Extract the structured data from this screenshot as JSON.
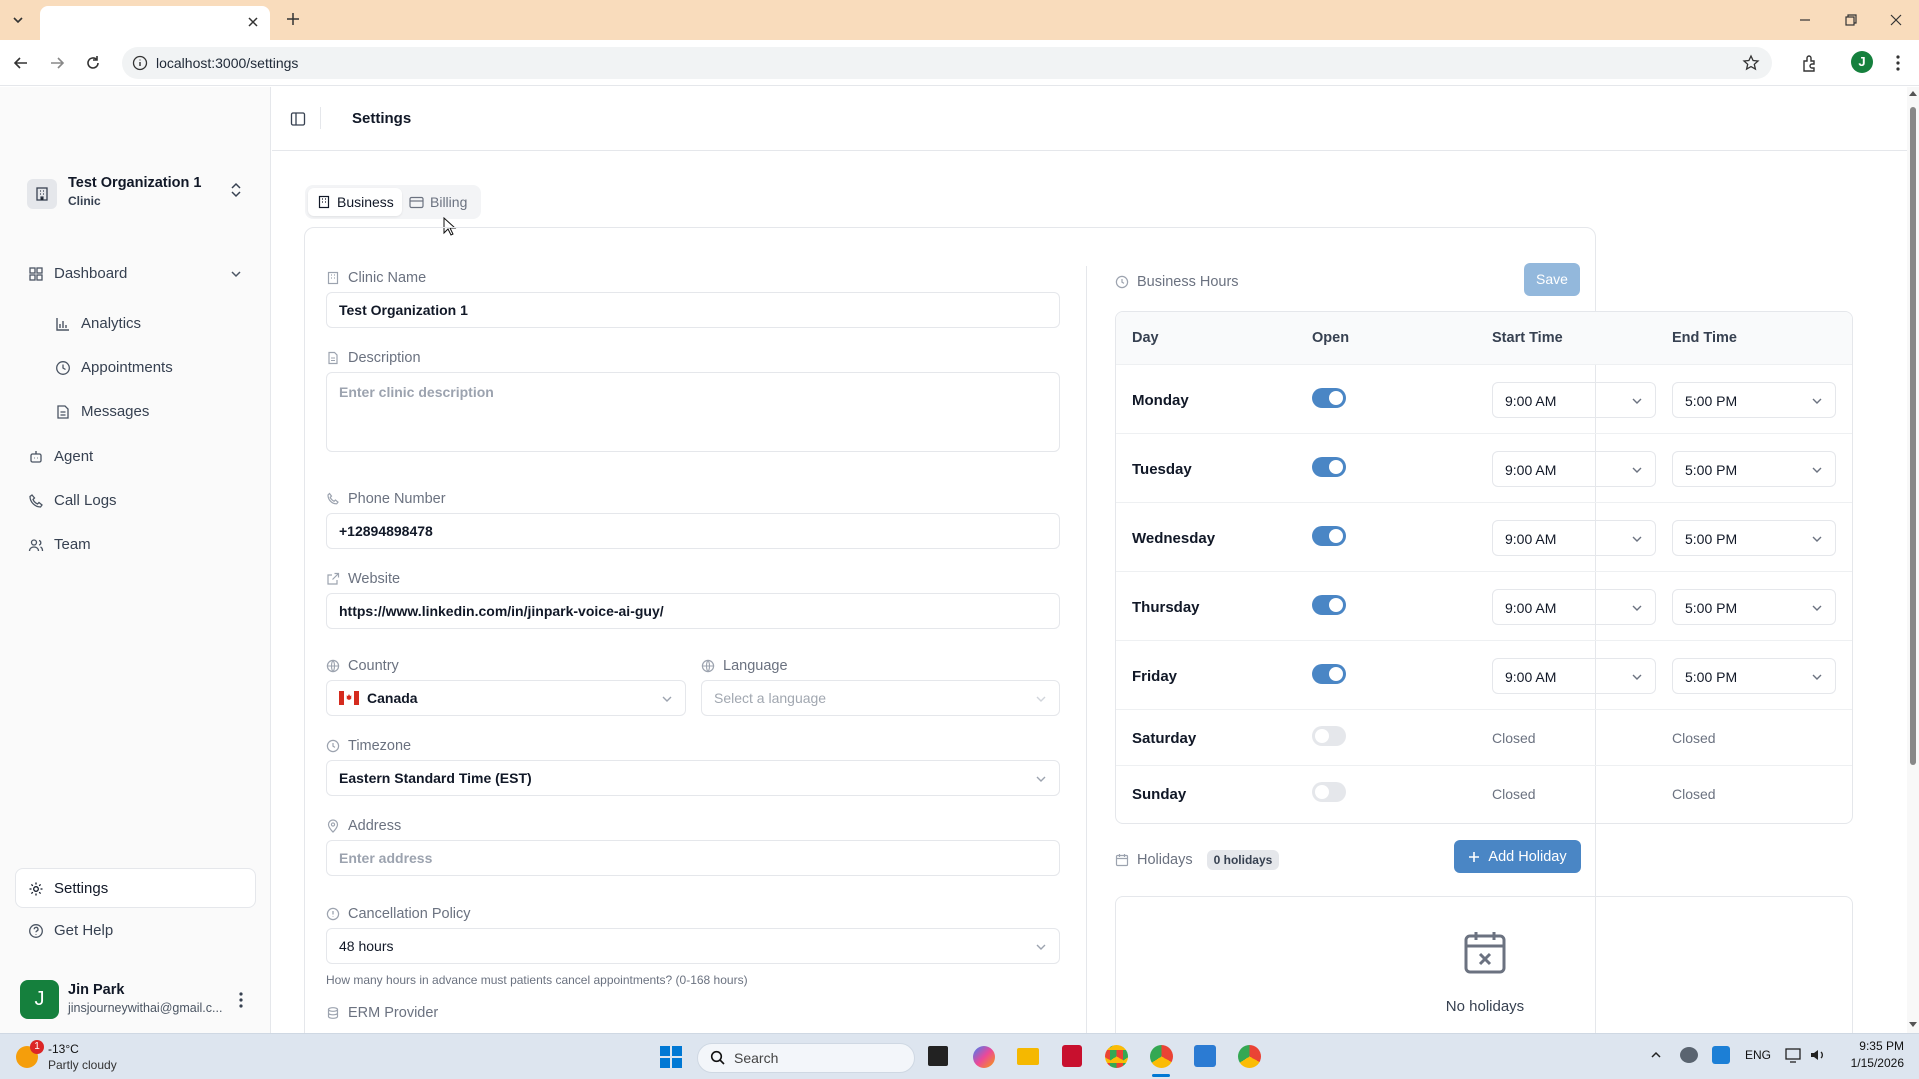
{
  "browser": {
    "url": "localhost:3000/settings",
    "profile_initial": "J"
  },
  "org": {
    "name": "Test Organization 1",
    "type": "Clinic"
  },
  "sidebar": {
    "dashboard": "Dashboard",
    "analytics": "Analytics",
    "appointments": "Appointments",
    "messages": "Messages",
    "agent": "Agent",
    "call_logs": "Call Logs",
    "team": "Team",
    "settings": "Settings",
    "get_help": "Get Help"
  },
  "user": {
    "initial": "J",
    "name": "Jin Park",
    "email": "jinsjourneywithai@gmail.c..."
  },
  "header": {
    "title": "Settings"
  },
  "tabs": {
    "business": "Business",
    "billing": "Billing"
  },
  "form": {
    "clinic_name_label": "Clinic Name",
    "clinic_name_value": "Test Organization 1",
    "description_label": "Description",
    "description_placeholder": "Enter clinic description",
    "phone_label": "Phone Number",
    "phone_value": "+12894898478",
    "website_label": "Website",
    "website_value": "https://www.linkedin.com/in/jinpark-voice-ai-guy/",
    "country_label": "Country",
    "country_value": "Canada",
    "language_label": "Language",
    "language_placeholder": "Select a language",
    "timezone_label": "Timezone",
    "timezone_value": "Eastern Standard Time (EST)",
    "address_label": "Address",
    "address_placeholder": "Enter address",
    "cancellation_label": "Cancellation Policy",
    "cancellation_value": "48 hours",
    "cancellation_help": "How many hours in advance must patients cancel appointments? (0-168 hours)",
    "erm_label": "ERM Provider"
  },
  "hours": {
    "title": "Business Hours",
    "save": "Save",
    "col_day": "Day",
    "col_open": "Open",
    "col_start": "Start Time",
    "col_end": "End Time",
    "days": [
      {
        "name": "Monday",
        "open": true,
        "start": "9:00 AM",
        "end": "5:00 PM"
      },
      {
        "name": "Tuesday",
        "open": true,
        "start": "9:00 AM",
        "end": "5:00 PM"
      },
      {
        "name": "Wednesday",
        "open": true,
        "start": "9:00 AM",
        "end": "5:00 PM"
      },
      {
        "name": "Thursday",
        "open": true,
        "start": "9:00 AM",
        "end": "5:00 PM"
      },
      {
        "name": "Friday",
        "open": true,
        "start": "9:00 AM",
        "end": "5:00 PM"
      },
      {
        "name": "Saturday",
        "open": false,
        "start": "Closed",
        "end": "Closed"
      },
      {
        "name": "Sunday",
        "open": false,
        "start": "Closed",
        "end": "Closed"
      }
    ]
  },
  "holidays": {
    "title": "Holidays",
    "count_badge": "0 holidays",
    "add_button": "Add Holiday",
    "empty_text": "No holidays"
  },
  "taskbar": {
    "weather_temp": "-13°C",
    "weather_desc": "Partly cloudy",
    "weather_badge": "1",
    "search": "Search",
    "lang": "ENG",
    "time": "9:35 PM",
    "date": "1/15/2026"
  },
  "colors": {
    "accent": "#4a86c5",
    "save_disabled": "#93b8dc",
    "tabbar": "#f9dcbc",
    "avatar": "#15803d"
  }
}
